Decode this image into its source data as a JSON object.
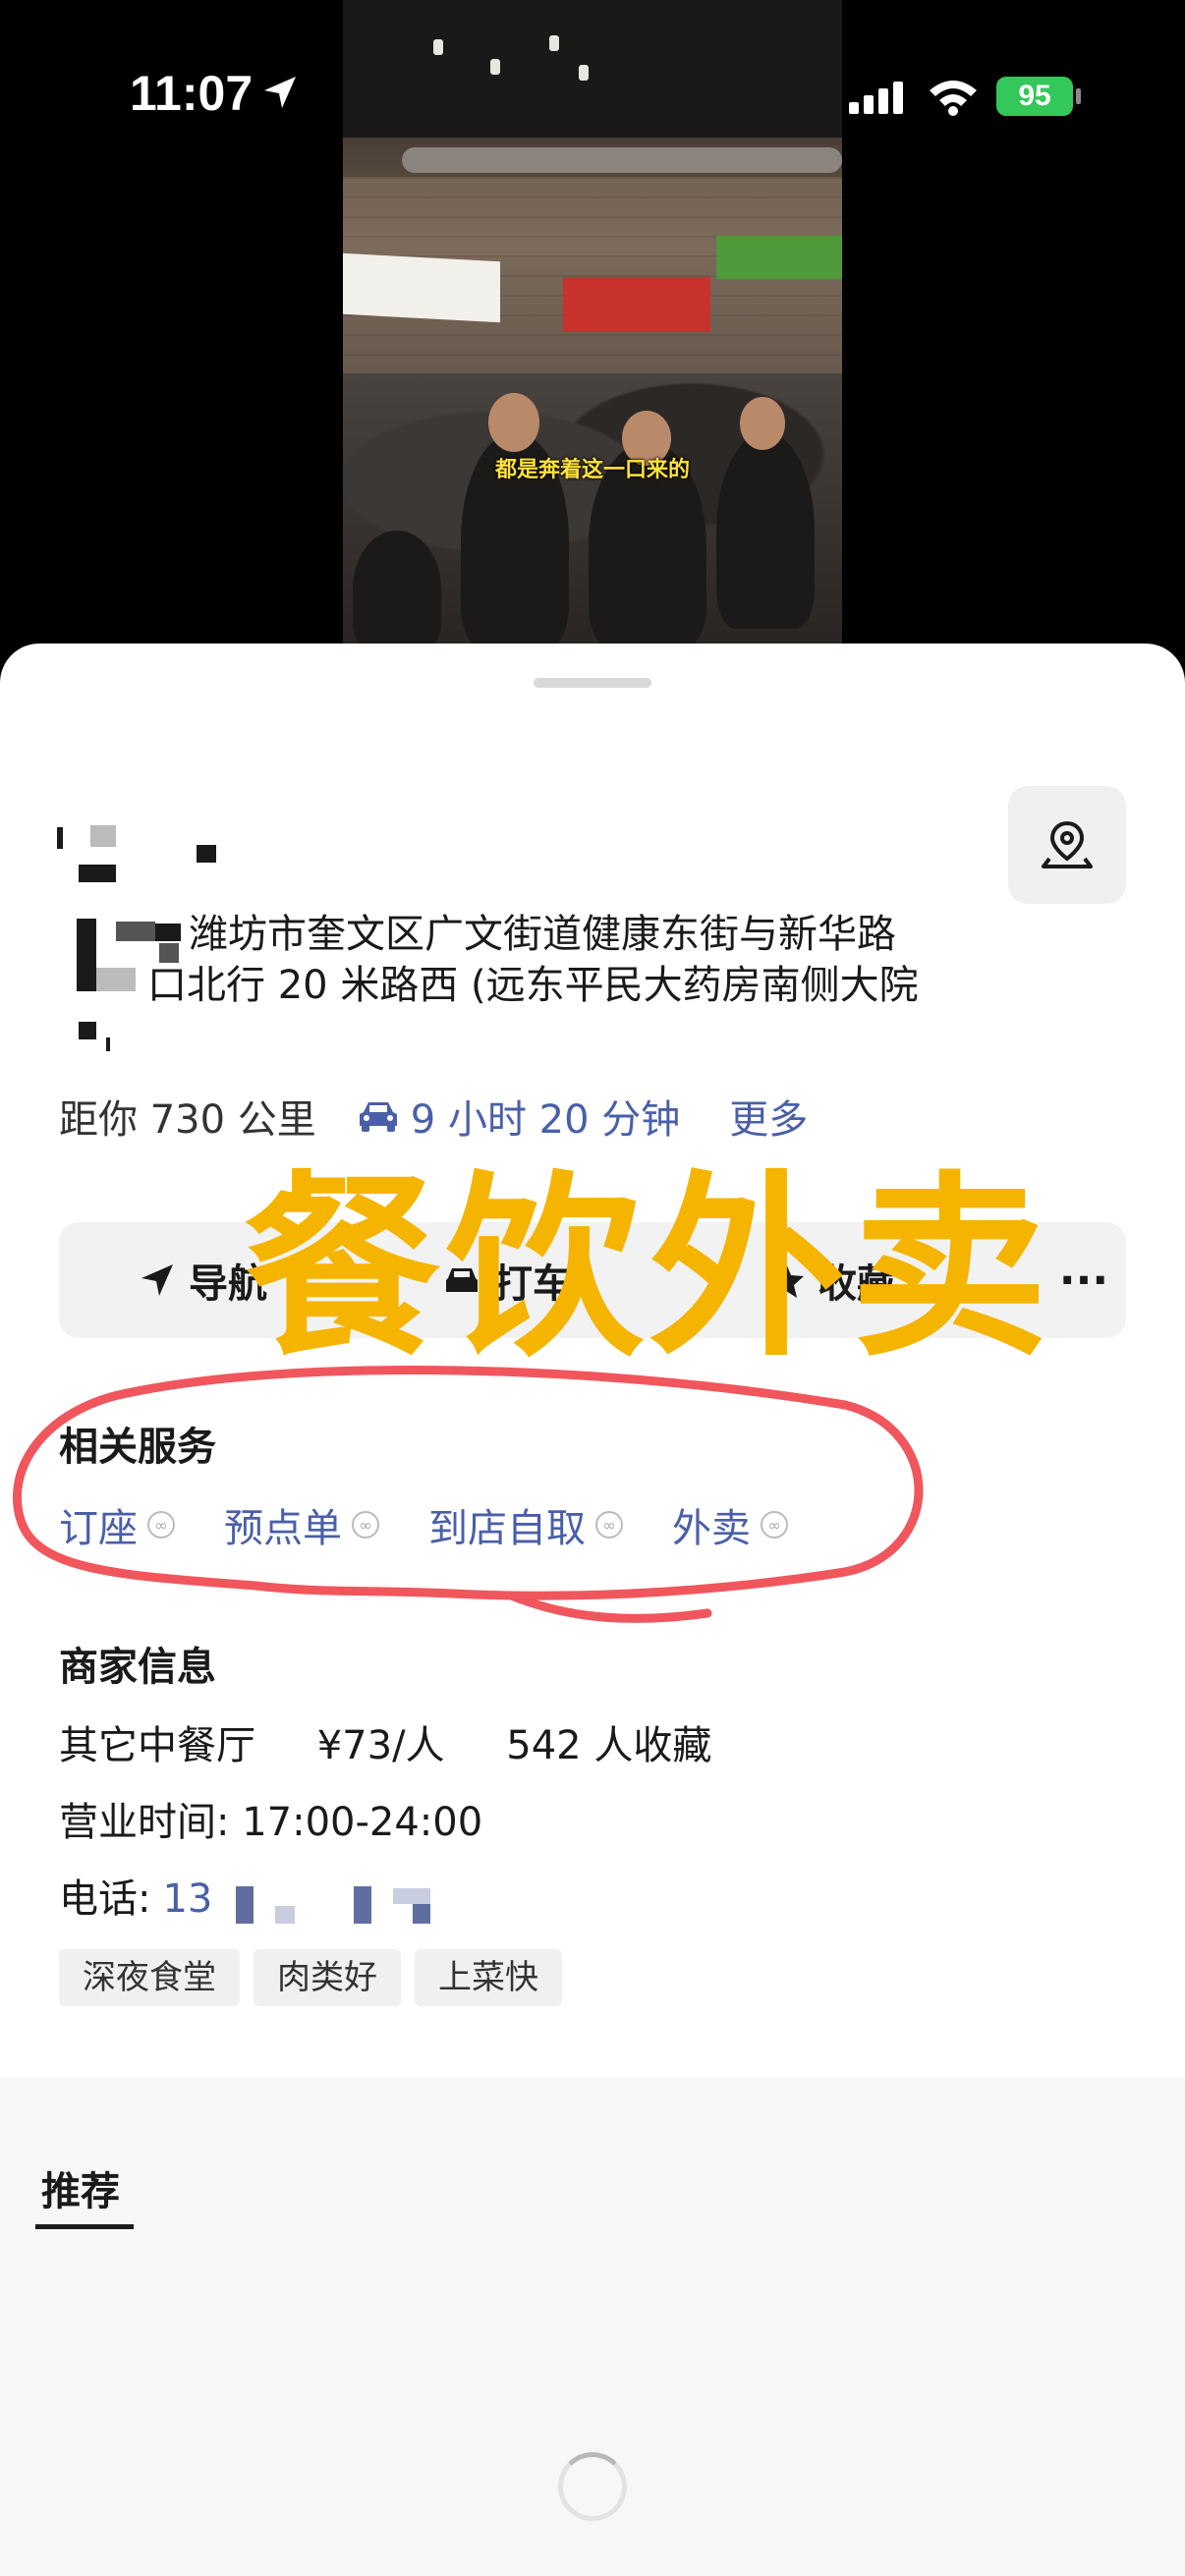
{
  "status": {
    "time": "11:07",
    "battery": "95"
  },
  "video": {
    "subtitle": "都是奔着这一口来的"
  },
  "place": {
    "address_line1": "潍坊市奎文区广文街道健康东街与新华路",
    "address_line2": "口北行 20 米路西 (远东平民大药房南侧大院",
    "distance": "距你 730 公里",
    "drive_time": "9 小时 20 分钟",
    "more": "更多"
  },
  "actions": {
    "navigate": "导航",
    "taxi": "打车",
    "favorite": "收藏",
    "more": "···"
  },
  "overlay_text": "餐饮外卖",
  "services": {
    "title": "相关服务",
    "items": [
      "订座",
      "预点单",
      "到店自取",
      "外卖"
    ]
  },
  "merchant": {
    "title": "商家信息",
    "category": "其它中餐厅",
    "price": "¥73/人",
    "favorites": "542 人收藏",
    "hours": "营业时间: 17:00-24:00",
    "phone_label": "电话:",
    "phone_value": "13",
    "tags": [
      "深夜食堂",
      "肉类好",
      "上菜快"
    ]
  },
  "tabs": {
    "recommend": "推荐"
  },
  "colors": {
    "link": "#4a5fa8",
    "overlay": "#f5b400",
    "annotation": "#f0565c",
    "battery": "#34c759"
  }
}
